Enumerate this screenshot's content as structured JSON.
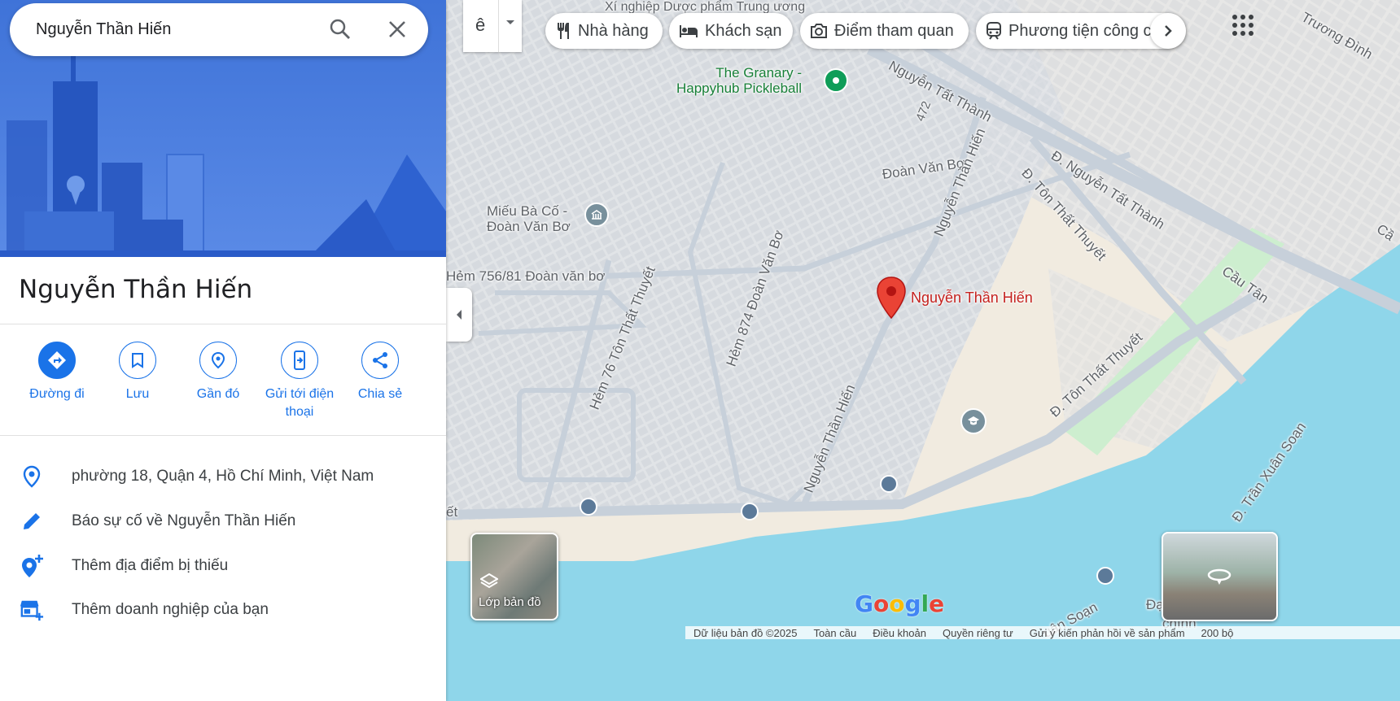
{
  "search": {
    "query": "Nguyễn Thần Hiến"
  },
  "place": {
    "title": "Nguyễn Thần Hiến"
  },
  "actions": [
    {
      "label": "Đường đi"
    },
    {
      "label": "Lưu"
    },
    {
      "label": "Gần đó"
    },
    {
      "label": "Gửi tới điện thoại"
    },
    {
      "label": "Chia sẻ"
    }
  ],
  "info": {
    "address": "phường 18, Quận 4, Hồ Chí Minh, Việt Nam",
    "report": "Báo sự cố về Nguyễn Thần Hiến",
    "add_place": "Thêm địa điểm bị thiếu",
    "add_business": "Thêm doanh nghiệp của bạn"
  },
  "lang_glyph": "ê",
  "chips": [
    "Nhà hàng",
    "Khách sạn",
    "Điểm tham quan",
    "Phương tiện công cộng"
  ],
  "map_labels": {
    "poi_pickleball": "The Granary -\nHappyhub Pickleball",
    "poi_temple": "Miếu Bà Cố -\nĐoàn Văn Bơ",
    "pin_label": "Nguyễn Thần Hiến",
    "top_poi": "Xí nghiệp Dược\nphẩm Trung ương",
    "roads": {
      "nguyen_tat_thanh": "Nguyễn Tất Thành",
      "d_nguyen_tat_thanh": "Đ. Nguyễn Tất Thành",
      "doan_van_bo": "Đoàn Văn Bơ",
      "hem_756": "Hẻm 756/81 Đoàn văn bơ",
      "hem_76": "Hẻm 76 Tôn Thất Thuyết",
      "hem_874": "Hẻm 874 Đoàn Văn Bơ",
      "nth_upper": "Nguyễn Thần Hiến",
      "nth_lower": "Nguyễn Thần Hiến",
      "ton_that_thuyet_1": "Đ. Tôn Thất Thuyết",
      "ton_that_thuyet_2": "Đ. Tôn Thất Thuyết",
      "r472": "472",
      "truong_dinh": "Trương Đình",
      "cau_tan": "Cầu Tân",
      "cau": "Cầ",
      "tran_xuan_soan": "Đ. Trần Xuân Soạn",
      "xuan_soan": "uân Soạn",
      "dai": "Đại",
      "chinh": "chính",
      "left_cut": "ết"
    }
  },
  "layer_label": "Lớp bản đồ",
  "logo": "Google",
  "footer": [
    "Dữ liệu bản đồ ©2025",
    "Toàn cầu",
    "Điều khoản",
    "Quyền riêng tư",
    "Gửi ý kiến phản hồi về sản phẩm",
    "200 bộ"
  ],
  "colors": {
    "accent": "#1a73e8",
    "pin": "#ea4335",
    "water": "#8fd6ea",
    "land": "#f1ebe0",
    "poi_green": "#0f9d58"
  }
}
